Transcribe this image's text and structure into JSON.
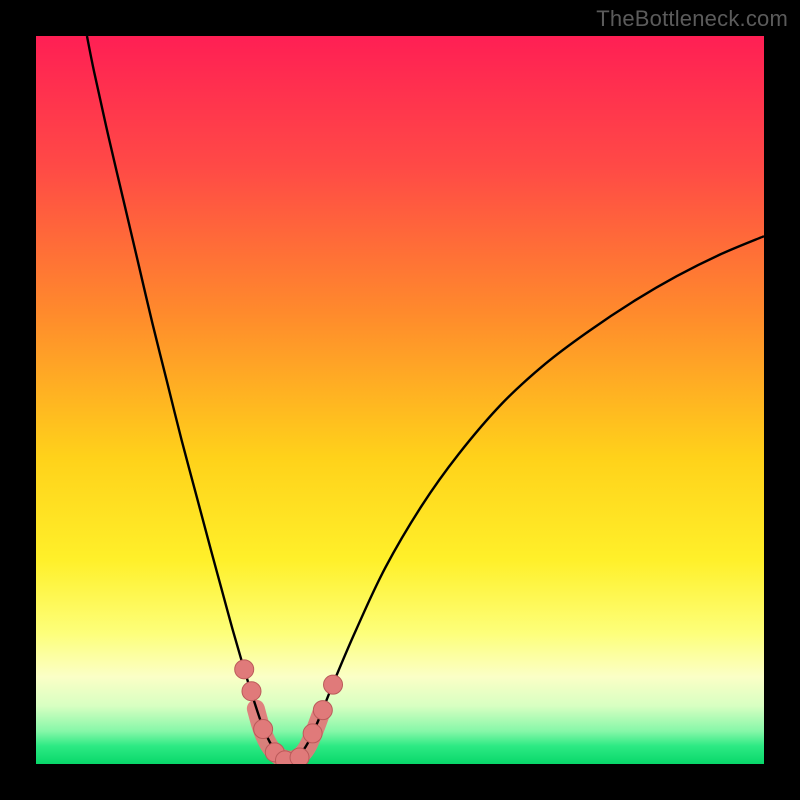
{
  "watermark": "TheBottleneck.com",
  "chart_data": {
    "type": "line",
    "title": "",
    "xlabel": "",
    "ylabel": "",
    "xlim": [
      0,
      100
    ],
    "ylim": [
      0,
      100
    ],
    "gradient_stops": [
      {
        "offset": 0.0,
        "color": "#ff1f54"
      },
      {
        "offset": 0.18,
        "color": "#ff4a46"
      },
      {
        "offset": 0.38,
        "color": "#ff8a2c"
      },
      {
        "offset": 0.58,
        "color": "#ffd21a"
      },
      {
        "offset": 0.72,
        "color": "#fff02a"
      },
      {
        "offset": 0.82,
        "color": "#fdff7a"
      },
      {
        "offset": 0.88,
        "color": "#fbffc6"
      },
      {
        "offset": 0.92,
        "color": "#d8ffc2"
      },
      {
        "offset": 0.955,
        "color": "#86f7a8"
      },
      {
        "offset": 0.975,
        "color": "#2eea84"
      },
      {
        "offset": 1.0,
        "color": "#08d86a"
      }
    ],
    "series": [
      {
        "name": "bottleneck-curve",
        "color": "#000000",
        "x": [
          7,
          8,
          10,
          12,
          14,
          16,
          18,
          20,
          22,
          24,
          25.5,
          27,
          28.6,
          30,
          31.2,
          32.4,
          33.6,
          35,
          36,
          37.4,
          39,
          41,
          44,
          48,
          53,
          58,
          64,
          70,
          76,
          82,
          88,
          94,
          100
        ],
        "y": [
          100,
          95,
          86,
          77.5,
          69,
          60.5,
          52.5,
          44.5,
          37,
          29.5,
          24,
          18.5,
          13,
          8.5,
          5,
          2.5,
          1,
          0.5,
          1,
          3,
          6.5,
          11.5,
          18.5,
          27,
          35.5,
          42.5,
          49.5,
          55,
          59.5,
          63.5,
          67,
          70,
          72.5
        ]
      }
    ],
    "markers": {
      "name": "curve-dots",
      "color": "#e07a7a",
      "outline": "#bb5a5a",
      "points": [
        {
          "x": 28.6,
          "y": 13
        },
        {
          "x": 29.6,
          "y": 10
        },
        {
          "x": 31.2,
          "y": 4.8
        },
        {
          "x": 32.8,
          "y": 1.6
        },
        {
          "x": 34.2,
          "y": 0.5
        },
        {
          "x": 36.2,
          "y": 0.9
        },
        {
          "x": 38.0,
          "y": 4.2
        },
        {
          "x": 39.4,
          "y": 7.4
        },
        {
          "x": 40.8,
          "y": 10.9
        }
      ]
    },
    "valley_band": {
      "name": "valley-band",
      "color": "#e07a7a",
      "points": [
        {
          "x": 30.2,
          "y": 7.6
        },
        {
          "x": 31.0,
          "y": 4.8
        },
        {
          "x": 32.0,
          "y": 2.6
        },
        {
          "x": 33.2,
          "y": 1.2
        },
        {
          "x": 34.6,
          "y": 0.6
        },
        {
          "x": 36.0,
          "y": 0.9
        },
        {
          "x": 37.2,
          "y": 2.2
        },
        {
          "x": 38.2,
          "y": 4.4
        },
        {
          "x": 39.1,
          "y": 6.8
        }
      ]
    }
  }
}
